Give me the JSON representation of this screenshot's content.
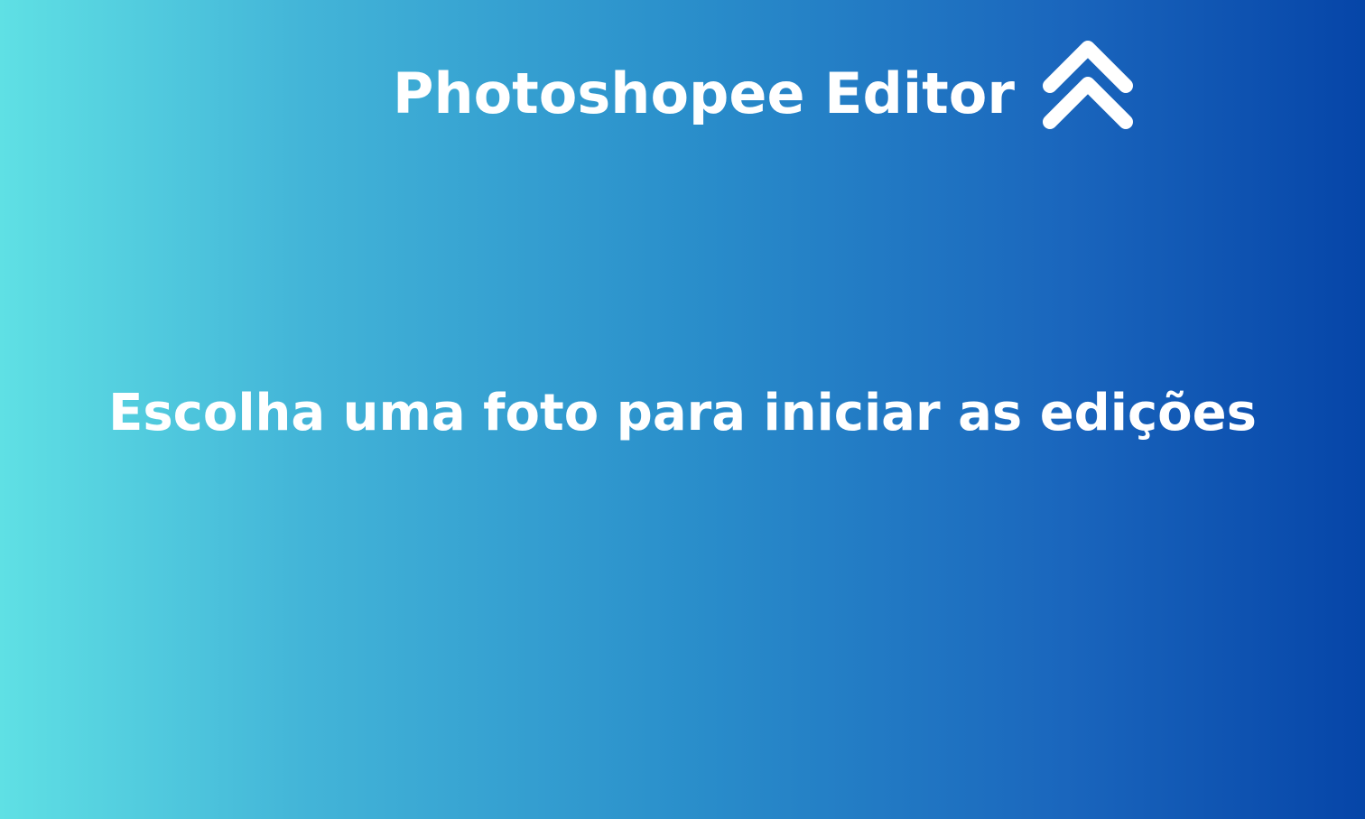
{
  "header": {
    "title": "Photoshopee Editor",
    "collapse_icon": "double-chevron-up-icon"
  },
  "main": {
    "prompt": "Escolha uma foto para iniciar as edições"
  },
  "colors": {
    "gradient_start": "#5fe0e4",
    "gradient_end": "#0645a8",
    "text": "#ffffff"
  }
}
